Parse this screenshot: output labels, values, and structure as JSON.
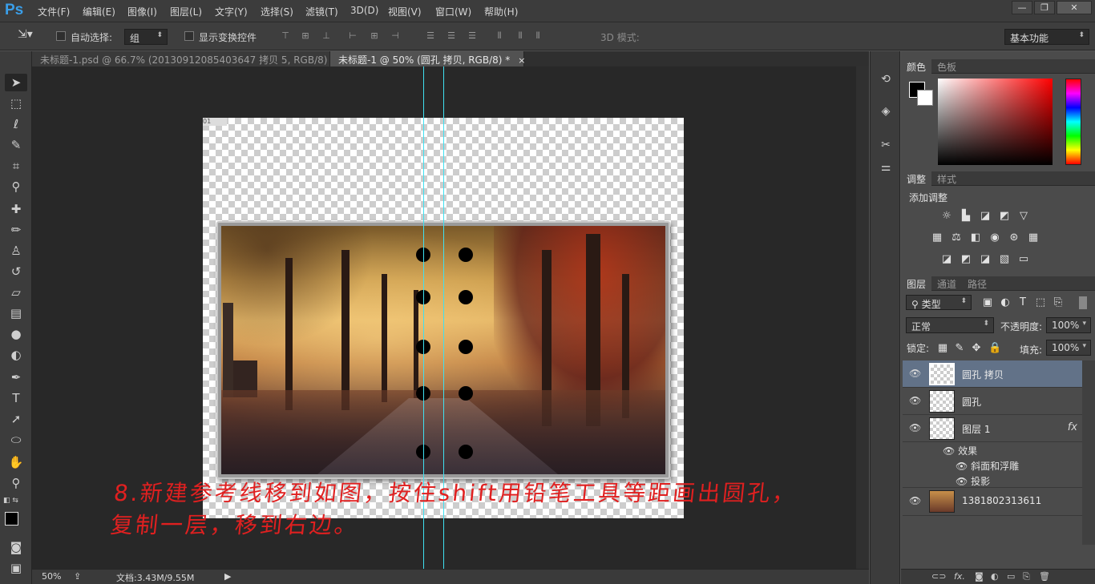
{
  "app": {
    "logo": "Ps"
  },
  "menu": [
    "文件(F)",
    "编辑(E)",
    "图像(I)",
    "图层(L)",
    "文字(Y)",
    "选择(S)",
    "滤镜(T)",
    "3D(D)",
    "视图(V)",
    "窗口(W)",
    "帮助(H)"
  ],
  "window_controls": {
    "minimize": "—",
    "restore": "❐",
    "close": "✕"
  },
  "options": {
    "auto_select_label": "自动选择:",
    "auto_select_value": "组",
    "show_transform_label": "显示变换控件",
    "mode_3d_label": "3D 模式:",
    "workspace": "基本功能"
  },
  "doc_tabs": [
    {
      "title": "未标题-1.psd @ 66.7% (20130912085403647 拷贝 5, RGB/8) *",
      "close": "×"
    },
    {
      "title": "未标题-1 @ 50% (圆孔 拷贝, RGB/8) *",
      "close": "×"
    }
  ],
  "doc_corner_label": "01",
  "caption": {
    "line1": "8.新建参考线移到如图，按住shift用铅笔工具等距画出圆孔，",
    "line2": "复制一层，移到右边。"
  },
  "status": {
    "zoom": "50%",
    "doc_size": "文档:3.43M/9.55M"
  },
  "panels": {
    "color": {
      "tabs": [
        "颜色",
        "色板"
      ]
    },
    "adjust": {
      "tabs": [
        "调整",
        "样式"
      ],
      "title": "添加调整"
    },
    "layers": {
      "tabs": [
        "图层",
        "通道",
        "路径"
      ],
      "filter_kind": "类型",
      "blend_mode": "正常",
      "opacity_label": "不透明度:",
      "opacity_value": "100%",
      "lock_label": "锁定:",
      "fill_label": "填充:",
      "fill_value": "100%",
      "rows": [
        {
          "name": "圆孔 拷贝",
          "selected": true
        },
        {
          "name": "圆孔",
          "selected": false
        },
        {
          "name": "图层 1",
          "selected": false,
          "fx": "fx"
        },
        {
          "name": "1381802313611",
          "selected": false
        }
      ],
      "effects_label": "效果",
      "effect_items": [
        "斜面和浮雕",
        "投影"
      ]
    }
  },
  "colors": {
    "accent_selected": "#627288",
    "guide": "#3fe0f0",
    "caption": "#e02020",
    "logo": "#3a9ee8"
  }
}
